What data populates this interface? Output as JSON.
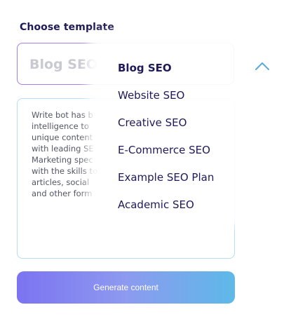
{
  "form": {
    "section_label": "Choose template",
    "template_select": {
      "value": "Blog SEO",
      "expanded": true
    },
    "description": "Write bot has b\nintelligence to \nunique content\nwith leading SE\nMarketing spec\nwith the skills to\narticles, social\nand other form",
    "generate_label": "Generate content"
  },
  "dropdown": {
    "options": [
      {
        "label": "Blog SEO",
        "selected": true
      },
      {
        "label": "Website SEO",
        "selected": false
      },
      {
        "label": "Creative SEO",
        "selected": false
      },
      {
        "label": "E-Commerce SEO",
        "selected": false
      },
      {
        "label": "Example SEO Plan",
        "selected": false
      },
      {
        "label": "Academic SEO",
        "selected": false
      }
    ]
  },
  "icons": {
    "chevron": "chevron-up-icon"
  },
  "colors": {
    "label_text": "#1e1a5a",
    "select_border": "#a77be8",
    "placeholder_text": "#c9c9d1",
    "textarea_border": "#b7dcf3",
    "chevron": "#5aa9d8",
    "button_gradient_start": "#7c73f1",
    "button_gradient_end": "#5db9e8"
  }
}
